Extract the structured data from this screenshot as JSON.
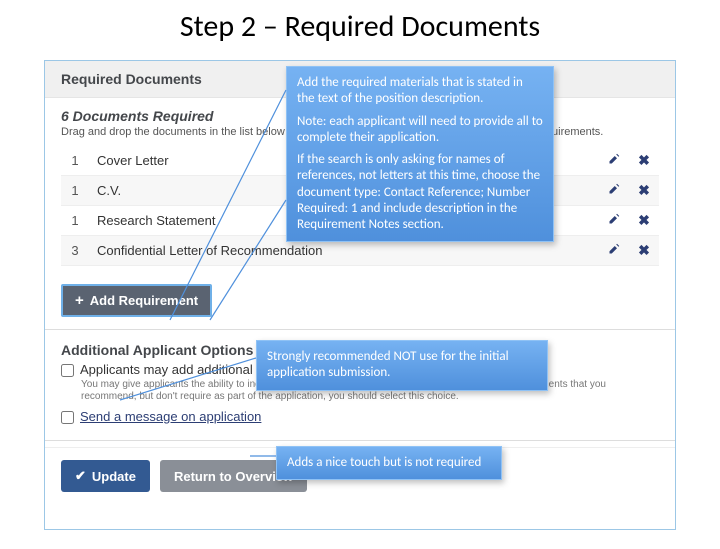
{
  "slide_title": "Step 2 – Required Documents",
  "panel": {
    "header": "Required Documents",
    "subhead": "6 Documents Required",
    "subtext": "Drag and drop the documents in the list below to change the order in which applicants will upload requirements.",
    "docs": [
      {
        "qty": "1",
        "name": "Cover Letter"
      },
      {
        "qty": "1",
        "name": "C.V."
      },
      {
        "qty": "1",
        "name": "Research Statement"
      },
      {
        "qty": "3",
        "name": "Confidential Letter of Recommendation"
      }
    ],
    "add_label": "Add Requirement",
    "opts_title": "Additional Applicant Options",
    "opt1_label": "Applicants may add additional documents",
    "opt1_desc": "You may give applicants the ability to include additional materials with their application. If you have documents that you recommend, but don't require as part of the application, you should select this choice.",
    "opt2_label": "Send a message on application",
    "update_label": "Update",
    "return_label": "Return to Overview"
  },
  "callouts": {
    "c1_p1": "Add the required materials that is stated in the text of the position description.",
    "c1_p2": "Note: each applicant will need to provide all to complete their application.",
    "c1_p3": "If the search is only asking for names of references, not letters at this time, choose the document type: Contact Reference; Number Required: 1 and include description in the Requirement Notes section.",
    "c2": "Strongly recommended NOT use for the initial application submission.",
    "c3": "Adds a nice touch but is not required"
  }
}
